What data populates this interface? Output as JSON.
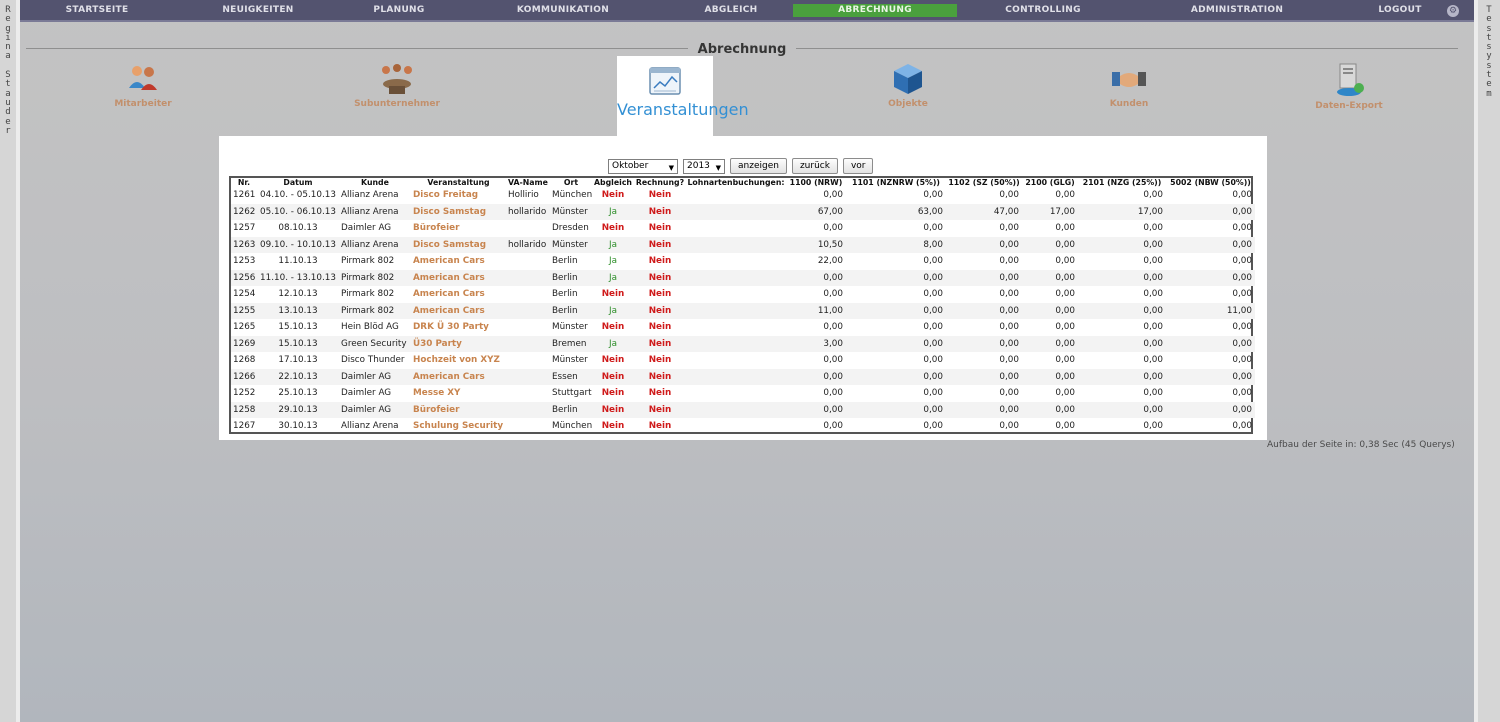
{
  "left_strip": "R\ne\ng\ni\nn\na\n \nS\nt\na\nu\nd\ne\nr",
  "right_strip": "T\ne\ns\nt\ns\ny\ns\nt\ne\nm",
  "nav": {
    "items": [
      "STARTSEITE",
      "NEUIGKEITEN",
      "PLANUNG",
      "KOMMUNIKATION",
      "ABGLEICH",
      "ABRECHNUNG",
      "CONTROLLING",
      "ADMINISTRATION",
      "LOGOUT"
    ],
    "active": "ABRECHNUNG",
    "gear": "⚙"
  },
  "page_title": "Abrechnung",
  "modules": {
    "mitarbeiter": "Mitarbeiter",
    "subunternehmer": "Subunternehmer",
    "veranstaltungen": "Veranstaltungen",
    "objekte": "Objekte",
    "kunden": "Kunden",
    "daten_export": "Daten-Export"
  },
  "controls": {
    "month": "Oktober",
    "year": "2013",
    "show_btn": "anzeigen",
    "back_btn": "zurück",
    "next_btn": "vor"
  },
  "table": {
    "headers": [
      "Nr.",
      "Datum",
      "Kunde",
      "Veranstaltung",
      "VA-Name",
      "Ort",
      "Abgleich",
      "Rechnung?",
      "Lohnartenbuchungen:",
      "1100 (NRW)",
      "1101 (NZNRW (5%))",
      "1102 (SZ (50%))",
      "2100 (GLG)",
      "2101 (NZG (25%))",
      "5002 (NBW (50%))"
    ],
    "rows": [
      {
        "nr": "1261",
        "datum": "04.10. - 05.10.13",
        "kunde": "Allianz Arena",
        "va": "Disco Freitag",
        "vaname": "Hollirio",
        "ort": "München",
        "abgleich": "Nein",
        "rechnung": "Nein",
        "v1": "0,00",
        "v2": "0,00",
        "v3": "0,00",
        "v4": "0,00",
        "v5": "0,00",
        "v6": "0,00"
      },
      {
        "nr": "1262",
        "datum": "05.10. - 06.10.13",
        "kunde": "Allianz Arena",
        "va": "Disco Samstag",
        "vaname": "hollarido",
        "ort": "Münster",
        "abgleich": "Ja",
        "rechnung": "Nein",
        "v1": "67,00",
        "v2": "63,00",
        "v3": "47,00",
        "v4": "17,00",
        "v5": "17,00",
        "v6": "0,00"
      },
      {
        "nr": "1257",
        "datum": "08.10.13",
        "kunde": "Daimler AG",
        "va": "Bürofeier",
        "vaname": "",
        "ort": "Dresden",
        "abgleich": "Nein",
        "rechnung": "Nein",
        "v1": "0,00",
        "v2": "0,00",
        "v3": "0,00",
        "v4": "0,00",
        "v5": "0,00",
        "v6": "0,00"
      },
      {
        "nr": "1263",
        "datum": "09.10. - 10.10.13",
        "kunde": "Allianz Arena",
        "va": "Disco Samstag",
        "vaname": "hollarido",
        "ort": "Münster",
        "abgleich": "Ja",
        "rechnung": "Nein",
        "v1": "10,50",
        "v2": "8,00",
        "v3": "0,00",
        "v4": "0,00",
        "v5": "0,00",
        "v6": "0,00"
      },
      {
        "nr": "1253",
        "datum": "11.10.13",
        "kunde": "Pirmark 802",
        "va": "American Cars",
        "vaname": "",
        "ort": "Berlin",
        "abgleich": "Ja",
        "rechnung": "Nein",
        "v1": "22,00",
        "v2": "0,00",
        "v3": "0,00",
        "v4": "0,00",
        "v5": "0,00",
        "v6": "0,00"
      },
      {
        "nr": "1256",
        "datum": "11.10. - 13.10.13",
        "kunde": "Pirmark 802",
        "va": "American Cars",
        "vaname": "",
        "ort": "Berlin",
        "abgleich": "Ja",
        "rechnung": "Nein",
        "v1": "0,00",
        "v2": "0,00",
        "v3": "0,00",
        "v4": "0,00",
        "v5": "0,00",
        "v6": "0,00"
      },
      {
        "nr": "1254",
        "datum": "12.10.13",
        "kunde": "Pirmark 802",
        "va": "American Cars",
        "vaname": "",
        "ort": "Berlin",
        "abgleich": "Nein",
        "rechnung": "Nein",
        "v1": "0,00",
        "v2": "0,00",
        "v3": "0,00",
        "v4": "0,00",
        "v5": "0,00",
        "v6": "0,00"
      },
      {
        "nr": "1255",
        "datum": "13.10.13",
        "kunde": "Pirmark 802",
        "va": "American Cars",
        "vaname": "",
        "ort": "Berlin",
        "abgleich": "Ja",
        "rechnung": "Nein",
        "v1": "11,00",
        "v2": "0,00",
        "v3": "0,00",
        "v4": "0,00",
        "v5": "0,00",
        "v6": "11,00"
      },
      {
        "nr": "1265",
        "datum": "15.10.13",
        "kunde": "Hein Blöd AG",
        "va": "DRK Ü 30 Party",
        "vaname": "",
        "ort": "Münster",
        "abgleich": "Nein",
        "rechnung": "Nein",
        "v1": "0,00",
        "v2": "0,00",
        "v3": "0,00",
        "v4": "0,00",
        "v5": "0,00",
        "v6": "0,00"
      },
      {
        "nr": "1269",
        "datum": "15.10.13",
        "kunde": "Green Security",
        "va": "Ü30 Party",
        "vaname": "",
        "ort": "Bremen",
        "abgleich": "Ja",
        "rechnung": "Nein",
        "v1": "3,00",
        "v2": "0,00",
        "v3": "0,00",
        "v4": "0,00",
        "v5": "0,00",
        "v6": "0,00"
      },
      {
        "nr": "1268",
        "datum": "17.10.13",
        "kunde": "Disco Thunder",
        "va": "Hochzeit von XYZ",
        "vaname": "",
        "ort": "Münster",
        "abgleich": "Nein",
        "rechnung": "Nein",
        "v1": "0,00",
        "v2": "0,00",
        "v3": "0,00",
        "v4": "0,00",
        "v5": "0,00",
        "v6": "0,00"
      },
      {
        "nr": "1266",
        "datum": "22.10.13",
        "kunde": "Daimler AG",
        "va": "American Cars",
        "vaname": "",
        "ort": "Essen",
        "abgleich": "Nein",
        "rechnung": "Nein",
        "v1": "0,00",
        "v2": "0,00",
        "v3": "0,00",
        "v4": "0,00",
        "v5": "0,00",
        "v6": "0,00"
      },
      {
        "nr": "1252",
        "datum": "25.10.13",
        "kunde": "Daimler AG",
        "va": "Messe XY",
        "vaname": "",
        "ort": "Stuttgart",
        "abgleich": "Nein",
        "rechnung": "Nein",
        "v1": "0,00",
        "v2": "0,00",
        "v3": "0,00",
        "v4": "0,00",
        "v5": "0,00",
        "v6": "0,00"
      },
      {
        "nr": "1258",
        "datum": "29.10.13",
        "kunde": "Daimler AG",
        "va": "Bürofeier",
        "vaname": "",
        "ort": "Berlin",
        "abgleich": "Nein",
        "rechnung": "Nein",
        "v1": "0,00",
        "v2": "0,00",
        "v3": "0,00",
        "v4": "0,00",
        "v5": "0,00",
        "v6": "0,00"
      },
      {
        "nr": "1267",
        "datum": "30.10.13",
        "kunde": "Allianz Arena",
        "va": "Schulung Security",
        "vaname": "",
        "ort": "München",
        "abgleich": "Nein",
        "rechnung": "Nein",
        "v1": "0,00",
        "v2": "0,00",
        "v3": "0,00",
        "v4": "0,00",
        "v5": "0,00",
        "v6": "0,00"
      }
    ]
  },
  "footer_note": "Aufbau der Seite in: 0,38 Sec (45 Querys)",
  "colors": {
    "nav_bg": "#53536f",
    "active_tab": "#4aa03d",
    "link_orange": "#c8844e",
    "nein_red": "#cf1a1a",
    "ja_green": "#2f8f2b"
  }
}
